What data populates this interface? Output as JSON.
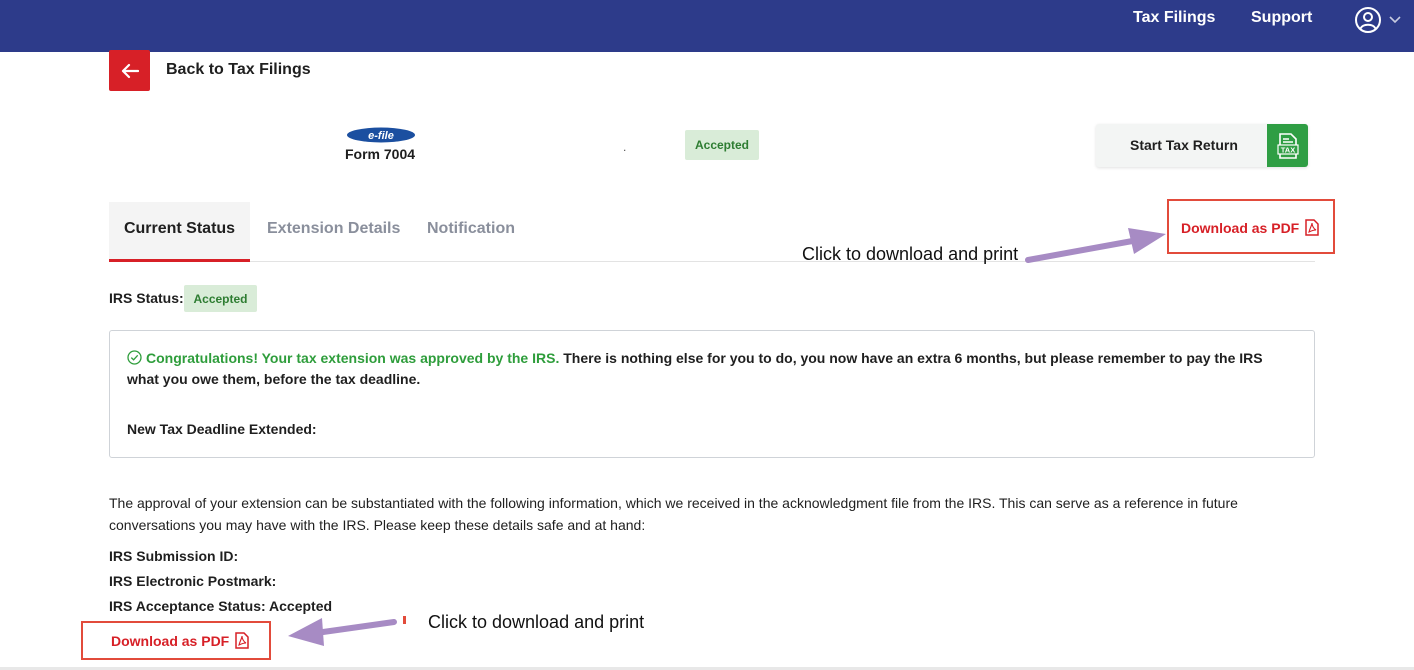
{
  "nav": {
    "tax_filings": "Tax Filings",
    "support": "Support"
  },
  "back": {
    "label": "Back to Tax Filings"
  },
  "filing": {
    "logo_text": "e-file",
    "form": "Form 7004",
    "separator": ".",
    "status": "Accepted"
  },
  "start_return": {
    "label": "Start Tax Return",
    "icon_text": "TAX"
  },
  "tabs": [
    {
      "label": "Current Status"
    },
    {
      "label": "Extension Details"
    },
    {
      "label": "Notification"
    }
  ],
  "download": {
    "label": "Download as PDF"
  },
  "annotations": {
    "top": "Click to download and print",
    "bottom": "Click to download and print"
  },
  "irs_status": {
    "label": "IRS Status:",
    "value": "Accepted"
  },
  "congrats": {
    "highlight": "Congratulations! Your tax extension was approved by the IRS.",
    "rest": "There is nothing else for you to do, you now have an extra 6 months, but please remember to pay the IRS what you owe them, before the tax deadline.",
    "deadline_label": "New Tax Deadline Extended:"
  },
  "info": {
    "paragraph": "The approval of your extension can be substantiated with the following information, which we received in the acknowledgment file from the IRS. This can serve as a reference in future conversations you may have with the IRS. Please keep these details safe and at hand:",
    "submission_id": "IRS Submission ID:",
    "postmark": "IRS Electronic Postmark:",
    "acceptance": "IRS Acceptance Status: Accepted"
  },
  "colors": {
    "header": "#2d3b8a",
    "accent_red": "#d72027",
    "success_green": "#2e9d3b",
    "badge_bg": "#d9ecd8",
    "annotation_box": "#e24b3b",
    "arrow": "#a78bc4"
  },
  "icons": {
    "back": "arrow-left-icon",
    "profile": "user-circle-icon",
    "dropdown": "chevron-down-icon",
    "tax": "tax-document-icon",
    "pdf": "pdf-file-icon",
    "check": "check-circle-icon"
  }
}
